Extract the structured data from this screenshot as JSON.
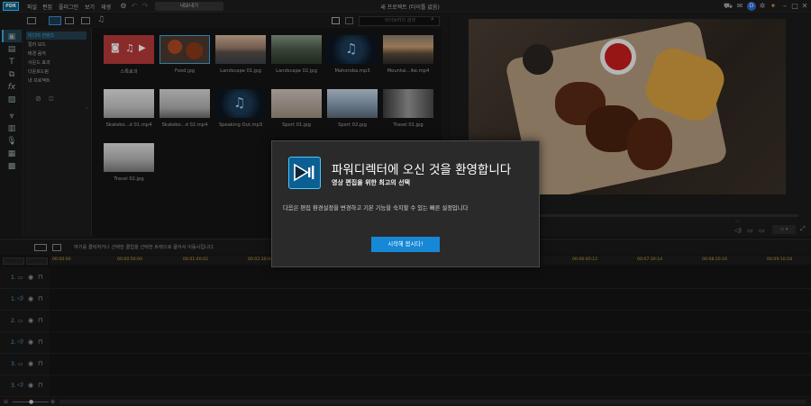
{
  "app": {
    "logo_text": "PDR",
    "window_title": "새 프로젝트 (타이틀 없음)"
  },
  "menu": [
    "파일",
    "편집",
    "플러그인",
    "보기",
    "재생"
  ],
  "toolbar": {
    "upload_label": "내보내기"
  },
  "library": {
    "search_placeholder": "라이브러리 검색",
    "tree": [
      "미디어 컨텐츠",
      "컬러 보드",
      "배경 음악",
      "사운드 효과",
      "다운로드됨",
      "내 프로젝트"
    ],
    "items": [
      {
        "name": "스톡효과",
        "kind": "stock"
      },
      {
        "name": "Food.jpg",
        "kind": "food"
      },
      {
        "name": "Landscape 01.jpg",
        "kind": "land1"
      },
      {
        "name": "Landscape 02.jpg",
        "kind": "land2"
      },
      {
        "name": "Mahoroba.mp3",
        "kind": "audio"
      },
      {
        "name": "Mountai...ike.mp4",
        "kind": "mount"
      },
      {
        "name": "Skatebo...d 01.mp4",
        "kind": "skate1"
      },
      {
        "name": "Skatebo...d 02.mp4",
        "kind": "skate2"
      },
      {
        "name": "Speaking Out.mp3",
        "kind": "audio"
      },
      {
        "name": "Sport 01.jpg",
        "kind": "sport1"
      },
      {
        "name": "Sport 02.jpg",
        "kind": "sport2"
      },
      {
        "name": "Travel 01.jpg",
        "kind": "travel1"
      },
      {
        "name": "Travel 02.jpg",
        "kind": "travel2"
      }
    ]
  },
  "timeline": {
    "hint": "여기를 클릭하거나 선택한 클립을 선택한 트랙으로 끌어서 이동시킵니다.",
    "ticks": [
      "00:00:00",
      "00:00:50:00",
      "00:01:40:02",
      "00:02:30:04",
      "00:03:20:06",
      "00:04:10:08",
      "00:05:00:10",
      "00:05:50:12",
      "00:06:40:12",
      "00:07:30:14",
      "00:08:20:16",
      "00:09:10:18"
    ],
    "tracks": [
      "1.",
      "1.",
      "2.",
      "2.",
      "3.",
      "3."
    ]
  },
  "dialog": {
    "title": "파워디렉터에 오신 것을 환영합니다",
    "subtitle": "영상 편집을 위한 최고의 선택",
    "description": "다음은 편집 환경설정을 변경하고 기본 기능을 숙지할 수 있는 빠른 설정입니다",
    "button": "시작해 봅시다!"
  },
  "colors": {
    "accent": "#1688d6",
    "timecode": "#c8a037",
    "track_icon": "#4fa3d8"
  }
}
